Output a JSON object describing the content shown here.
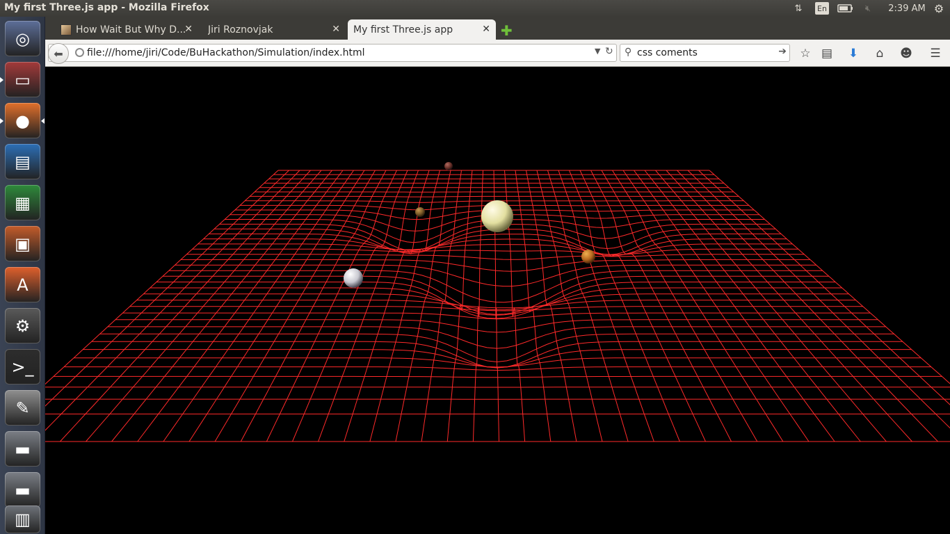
{
  "panel": {
    "window_title": "My first Three.js app - Mozilla Firefox",
    "keyboard_layout": "En",
    "clock": "2:39 AM"
  },
  "launcher": {
    "items": [
      {
        "name": "dash-home",
        "icon": "ubuntu-logo-icon",
        "color": "#5d6f99"
      },
      {
        "name": "files",
        "icon": "file-cabinet-icon",
        "color": "#a33a3a"
      },
      {
        "name": "firefox",
        "icon": "firefox-icon",
        "color": "#e2702b"
      },
      {
        "name": "writer",
        "icon": "writer-doc-icon",
        "color": "#2c6fb6"
      },
      {
        "name": "calc",
        "icon": "calc-sheet-icon",
        "color": "#2e8a3b"
      },
      {
        "name": "impress",
        "icon": "impress-slide-icon",
        "color": "#c45c2a"
      },
      {
        "name": "software-center",
        "icon": "shopping-bag-icon",
        "color": "#e0602c"
      },
      {
        "name": "system-settings",
        "icon": "gear-wrench-icon",
        "color": "#5a5a5a"
      },
      {
        "name": "terminal",
        "icon": "terminal-icon",
        "color": "#2d2d2d"
      },
      {
        "name": "text-editor",
        "icon": "text-editor-icon",
        "color": "#8f8f8f"
      },
      {
        "name": "drive-1",
        "icon": "hard-drive-icon",
        "color": "#7b7f86"
      },
      {
        "name": "drive-2",
        "icon": "hard-drive-icon",
        "color": "#7b7f86"
      },
      {
        "name": "trash",
        "icon": "trash-icon",
        "color": "#6f737a"
      }
    ]
  },
  "tabs": [
    {
      "label": "How Wait But Why D...",
      "active": false
    },
    {
      "label": "Jiri Roznovjak",
      "active": false
    },
    {
      "label": "My first Three.js app",
      "active": true
    }
  ],
  "navbar": {
    "url": "file:///home/jiri/Code/BuHackathon/Simulation/index.html",
    "search_value": "css coments"
  },
  "scene": {
    "grid_color": "#ff2a2a",
    "background": "#000000"
  }
}
